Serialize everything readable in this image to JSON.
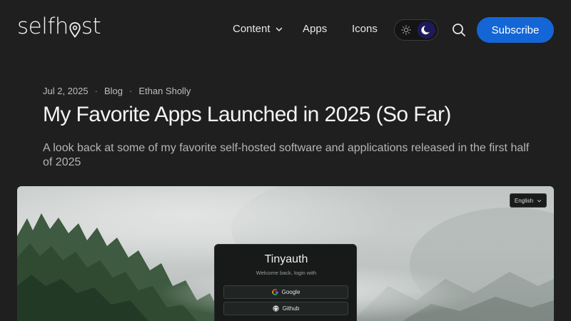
{
  "header": {
    "logo_left": "selfh",
    "logo_right": "st",
    "nav": {
      "content": "Content",
      "apps": "Apps",
      "icons": "Icons"
    },
    "theme": {
      "light_icon": "sun-icon",
      "dark_icon": "moon-icon",
      "selected": "dark"
    },
    "search_icon": "search-icon",
    "subscribe_label": "Subscribe"
  },
  "article": {
    "date": "Jul 2, 2025",
    "tag": "Blog",
    "author": "Ethan Sholly",
    "title": "My Favorite Apps Launched in 2025 (So Far)",
    "subtitle": "A look back at some of my favorite self-hosted software and applications released in the first half of 2025"
  },
  "hero": {
    "language_label": "English",
    "card_title": "Tinyauth",
    "card_subtitle": "Welcome back, login with",
    "google_label": "Google",
    "github_label": "Github"
  },
  "colors": {
    "background": "#1f1f20",
    "accent": "#1466d6",
    "toggle_active": "#1d1a5c"
  }
}
